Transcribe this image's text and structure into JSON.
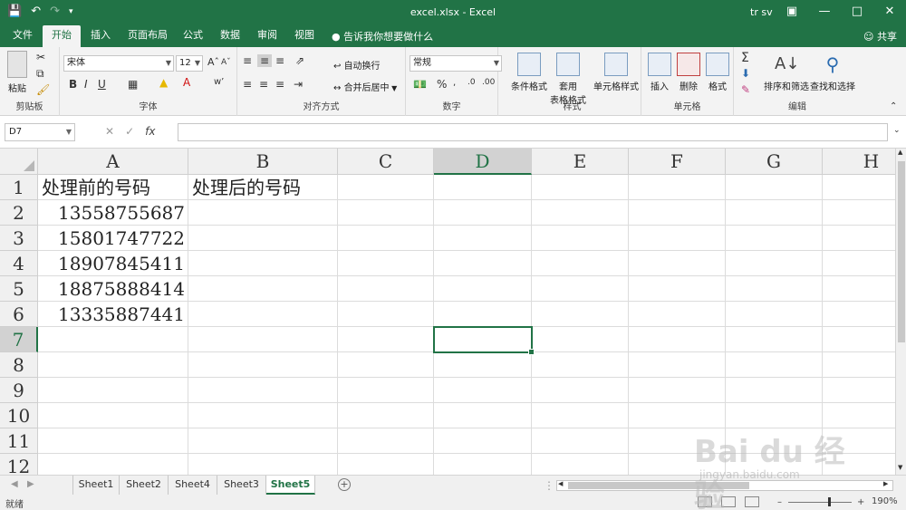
{
  "window": {
    "title": "excel.xlsx  -  Excel",
    "user": "tr sv"
  },
  "ribbon_tabs": [
    "文件",
    "开始",
    "插入",
    "页面布局",
    "公式",
    "数据",
    "审阅",
    "视图"
  ],
  "active_tab": "开始",
  "tell_me": "告诉我你想要做什么",
  "share": "共享",
  "ribbon": {
    "clipboard": {
      "paste": "粘贴",
      "label": "剪贴板"
    },
    "font": {
      "name": "宋体",
      "size": "12",
      "label": "字体"
    },
    "alignment": {
      "wrap": "自动换行",
      "merge": "合并后居中",
      "label": "对齐方式"
    },
    "number": {
      "format": "常规",
      "label": "数字"
    },
    "styles": {
      "conditional": "条件格式",
      "table_format_1": "套用",
      "table_format_2": "表格格式",
      "cell_styles": "单元格样式",
      "label": "样式"
    },
    "cells": {
      "insert": "插入",
      "delete": "删除",
      "format": "格式",
      "label": "单元格"
    },
    "editing": {
      "sort": "排序和筛选",
      "find": "查找和选择",
      "label": "编辑"
    }
  },
  "formula_bar": {
    "name_box": "D7",
    "fx": "fx",
    "content": ""
  },
  "columns": [
    "A",
    "B",
    "C",
    "D",
    "E",
    "F",
    "G",
    "H"
  ],
  "rows": [
    "1",
    "2",
    "3",
    "4",
    "5",
    "6",
    "7",
    "8",
    "9",
    "10",
    "11",
    "12"
  ],
  "selected_cell": {
    "column": "D",
    "row": "7"
  },
  "cells": {
    "A1": "处理前的号码",
    "B1": "处理后的号码",
    "A2": "13558755687",
    "A3": "15801747722",
    "A4": "18907845411",
    "A5": "18875888414",
    "A6": "13335887441"
  },
  "sheets": [
    "Sheet1",
    "Sheet2",
    "Sheet4",
    "Sheet3",
    "Sheet5"
  ],
  "active_sheet": "Sheet5",
  "status": {
    "ready": "就绪",
    "zoom": "190%"
  },
  "watermark": {
    "logo": "Bai du 经验",
    "url": "jingyan.baidu.com"
  },
  "colors": {
    "excel_green": "#217346",
    "selection": "#217346"
  }
}
